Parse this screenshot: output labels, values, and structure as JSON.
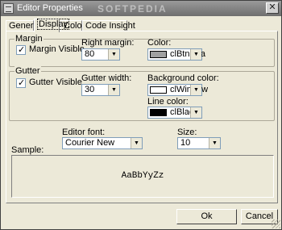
{
  "window": {
    "title": "Editor Properties",
    "watermark": "SOFTPEDIA",
    "close_glyph": "✕"
  },
  "tabs": [
    {
      "label": "General",
      "active": false
    },
    {
      "label": "Display",
      "active": true
    },
    {
      "label": "Color",
      "active": false
    },
    {
      "label": "Code Insight",
      "active": false
    }
  ],
  "margin": {
    "group_label": "Margin",
    "visible_label": "Margin Visible",
    "visible_checked": true,
    "right_margin_label": "Right margin:",
    "right_margin_value": "80",
    "color_label": "Color:",
    "color_value": "clBtnSha",
    "color_swatch": "#a0a0a0"
  },
  "gutter": {
    "group_label": "Gutter",
    "visible_label": "Gutter Visible",
    "visible_checked": true,
    "width_label": "Gutter width:",
    "width_value": "30",
    "bg_label": "Background color:",
    "bg_value": "clWindow",
    "bg_swatch": "#ffffff",
    "line_label": "Line color:",
    "line_value": "clBlack",
    "line_swatch": "#000000"
  },
  "font": {
    "label": "Editor font:",
    "value": "Courier New",
    "size_label": "Size:",
    "size_value": "10"
  },
  "sample": {
    "label": "Sample:",
    "text": "AaBbYyZz"
  },
  "buttons": {
    "ok": "Ok",
    "cancel": "Cancel"
  },
  "dropdown_arrow": "▼"
}
